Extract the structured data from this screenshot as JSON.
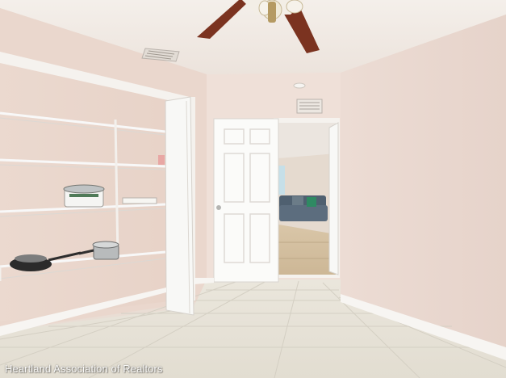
{
  "image": {
    "watermark": "Heartland Association of Realtors"
  },
  "scene": {
    "wall_color": "#ecdcd3",
    "ceiling_color": "#f2ece7",
    "floor_color": "#e8e3d8",
    "trim_color": "#f7f5f2",
    "fan_blade_color": "#7b3320"
  }
}
